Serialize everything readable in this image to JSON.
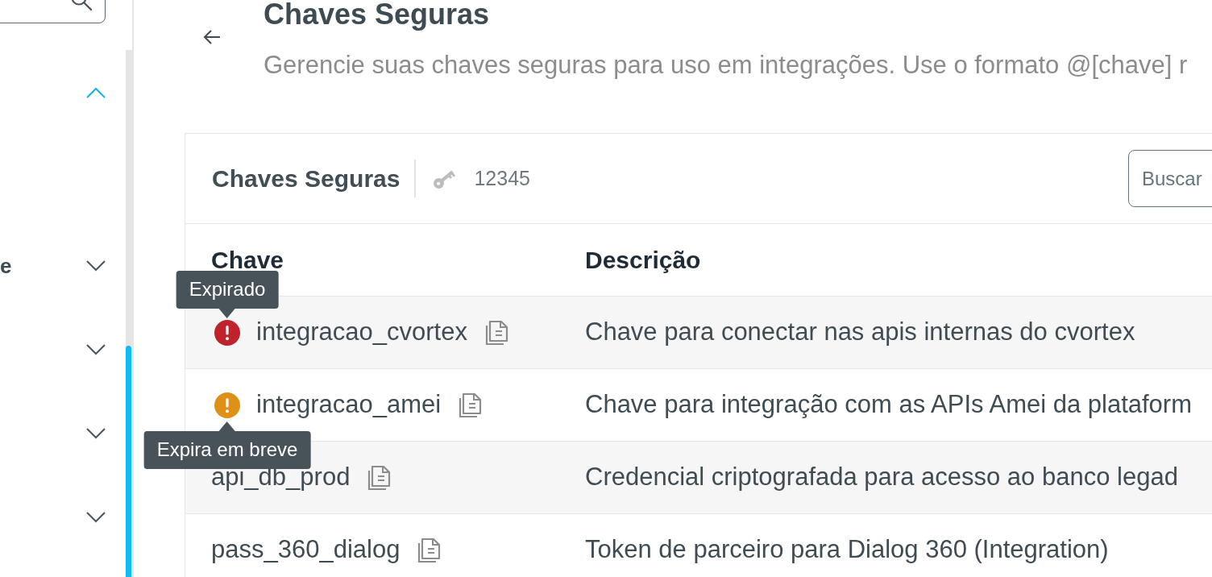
{
  "sidebar": {
    "items": [
      {
        "expanded": true
      },
      {
        "label": "e",
        "expanded": false
      },
      {
        "expanded": false
      },
      {
        "expanded": false
      },
      {
        "expanded": false
      }
    ]
  },
  "header": {
    "title": "Chaves Seguras",
    "subtitle": "Gerencie suas chaves seguras para uso em integrações. Use o formato @[chave] r"
  },
  "card": {
    "title": "Chaves Seguras",
    "count": "12345",
    "search": {
      "placeholder": "Buscar"
    }
  },
  "table": {
    "columns": [
      "Chave",
      "Descrição"
    ],
    "rows": [
      {
        "key": "integracao_cvortex",
        "description": "Chave para conectar nas apis internas do cvortex",
        "color": "#c0222b",
        "tooltip": {
          "text": "Expirado",
          "below": false
        }
      },
      {
        "key": "integracao_amei",
        "description": "Chave para integração com as APIs Amei da plataform",
        "color": "#df9117",
        "tooltip": {
          "text": "Expira em breve",
          "below": true
        }
      },
      {
        "key": "api_db_prod",
        "description": "Credencial criptografada para acesso ao banco legad"
      },
      {
        "key": "pass_360_dialog",
        "description": "Token de parceiro para Dialog 360 (Integration)"
      }
    ]
  }
}
